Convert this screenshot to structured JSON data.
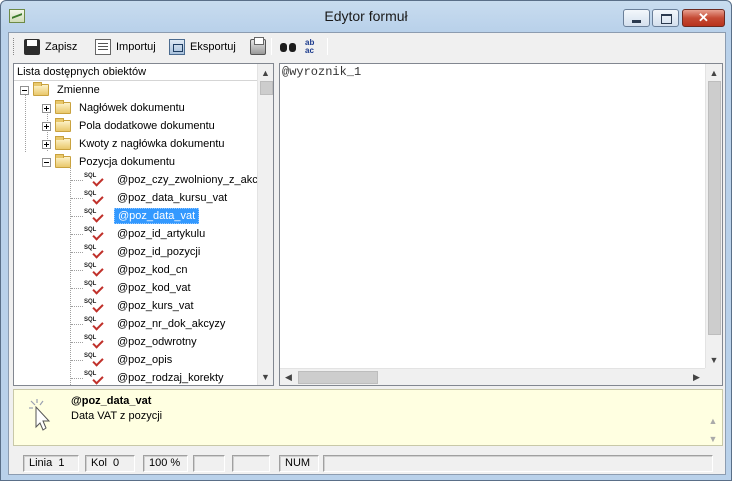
{
  "window": {
    "title": "Edytor formuł"
  },
  "toolbar": {
    "save_label": "Zapisz",
    "import_label": "Importuj",
    "export_label": "Eksportuj",
    "replace_icon_text": "ab ac"
  },
  "tree": {
    "header": "Lista dostępnych obiektów",
    "root": "Zmienne",
    "groups": [
      "Nagłówek dokumentu",
      "Pola dodatkowe dokumentu",
      "Kwoty z nagłówka dokumentu",
      "Pozycja dokumentu"
    ],
    "items": [
      "@poz_czy_zwolniony_z_akcyzy",
      "@poz_data_kursu_vat",
      "@poz_data_vat",
      "@poz_id_artykulu",
      "@poz_id_pozycji",
      "@poz_kod_cn",
      "@poz_kod_vat",
      "@poz_kurs_vat",
      "@poz_nr_dok_akcyzy",
      "@poz_odwrotny",
      "@poz_opis",
      "@poz_rodzaj_korekty"
    ],
    "selected_item": "@poz_data_vat",
    "sql_icon_text": "SQL"
  },
  "editor": {
    "content": "@wyroznik_1"
  },
  "description": {
    "title": "@poz_data_vat",
    "text": "Data VAT z pozycji"
  },
  "status": {
    "line_label": "Linia",
    "line_value": "1",
    "col_label": "Kol",
    "col_value": "0",
    "zoom": "100 %",
    "num": "NUM"
  }
}
